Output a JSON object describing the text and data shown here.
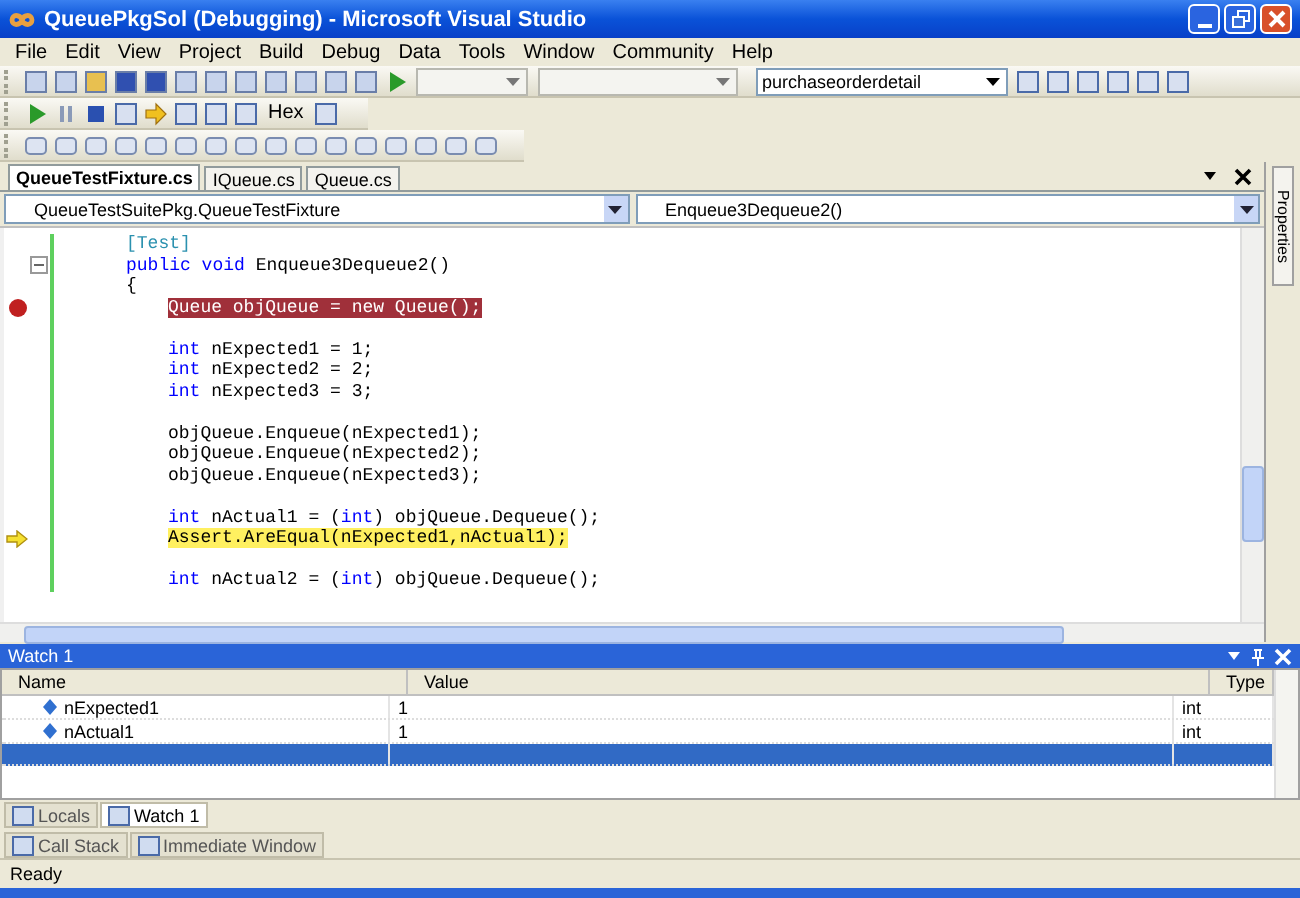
{
  "window": {
    "title": "QueuePkgSol (Debugging) - Microsoft Visual Studio"
  },
  "menu": [
    "File",
    "Edit",
    "View",
    "Project",
    "Build",
    "Debug",
    "Data",
    "Tools",
    "Window",
    "Community",
    "Help"
  ],
  "toolbar": {
    "find_value": "purchaseorderdetail",
    "hex_label": "Hex"
  },
  "doc_tabs": [
    {
      "label": "QueueTestFixture.cs",
      "selected": true
    },
    {
      "label": "IQueue.cs",
      "selected": false
    },
    {
      "label": "Queue.cs",
      "selected": false
    }
  ],
  "navigation": {
    "type_value": "QueueTestSuitePkg.QueueTestFixture",
    "member_value": "Enqueue3Dequeue2()"
  },
  "code_lines": [
    {
      "kind": "code",
      "segments": [
        {
          "kind": "attr",
          "text": "[Test]"
        }
      ]
    },
    {
      "kind": "code",
      "collapsible": true,
      "segments": [
        {
          "kind": "keyword",
          "text": "public void "
        },
        {
          "kind": "plain",
          "text": "Enqueue3Dequeue2()"
        }
      ]
    },
    {
      "kind": "code",
      "segments": [
        {
          "kind": "plain",
          "text": "{"
        }
      ],
      "children": [
        {
          "kind": "code",
          "breakpoint": true,
          "segments": [
            {
              "kind": "plain",
              "text": "Queue objQueue = new Queue();"
            }
          ]
        },
        {
          "kind": "blank"
        },
        {
          "kind": "code",
          "segments": [
            {
              "kind": "keyword",
              "text": "int "
            },
            {
              "kind": "plain",
              "text": "nExpected1 = 1;"
            }
          ]
        },
        {
          "kind": "code",
          "segments": [
            {
              "kind": "keyword",
              "text": "int "
            },
            {
              "kind": "plain",
              "text": "nExpected2 = 2;"
            }
          ]
        },
        {
          "kind": "code",
          "segments": [
            {
              "kind": "keyword",
              "text": "int "
            },
            {
              "kind": "plain",
              "text": "nExpected3 = 3;"
            }
          ]
        },
        {
          "kind": "blank"
        },
        {
          "kind": "code",
          "segments": [
            {
              "kind": "plain",
              "text": "objQueue.Enqueue(nExpected1);"
            }
          ]
        },
        {
          "kind": "code",
          "segments": [
            {
              "kind": "plain",
              "text": "objQueue.Enqueue(nExpected2);"
            }
          ]
        },
        {
          "kind": "code",
          "segments": [
            {
              "kind": "plain",
              "text": "objQueue.Enqueue(nExpected3);"
            }
          ]
        },
        {
          "kind": "blank"
        },
        {
          "kind": "code",
          "segments": [
            {
              "kind": "keyword",
              "text": "int "
            },
            {
              "kind": "plain",
              "text": "nActual1 = ("
            },
            {
              "kind": "keyword",
              "text": "int"
            },
            {
              "kind": "plain",
              "text": ") objQueue.Dequeue();"
            }
          ]
        },
        {
          "kind": "code",
          "current": true,
          "segments": [
            {
              "kind": "plain",
              "text": "Assert.AreEqual(nExpected1,nActual1);"
            }
          ]
        },
        {
          "kind": "blank"
        },
        {
          "kind": "code",
          "segments": [
            {
              "kind": "keyword",
              "text": "int "
            },
            {
              "kind": "plain",
              "text": "nActual2 = ("
            },
            {
              "kind": "keyword",
              "text": "int"
            },
            {
              "kind": "plain",
              "text": ") objQueue.Dequeue();"
            }
          ]
        }
      ]
    }
  ],
  "side_tab": {
    "label": "Properties"
  },
  "watch": {
    "title": "Watch 1",
    "columns": [
      "Name",
      "Value",
      "Type"
    ],
    "rows": [
      {
        "name": "nExpected1",
        "value": "1",
        "type": "int",
        "selected": false
      },
      {
        "name": "nActual1",
        "value": "1",
        "type": "int",
        "selected": false
      },
      {
        "selected": true
      }
    ]
  },
  "tool_tabs": [
    {
      "label": "Locals",
      "selected": false
    },
    {
      "label": "Watch 1",
      "selected": true
    }
  ],
  "tool_tabs_2": [
    {
      "label": "Call Stack",
      "selected": false
    },
    {
      "label": "Immediate Window",
      "selected": false
    }
  ],
  "status_bar": {
    "text": "Ready"
  }
}
